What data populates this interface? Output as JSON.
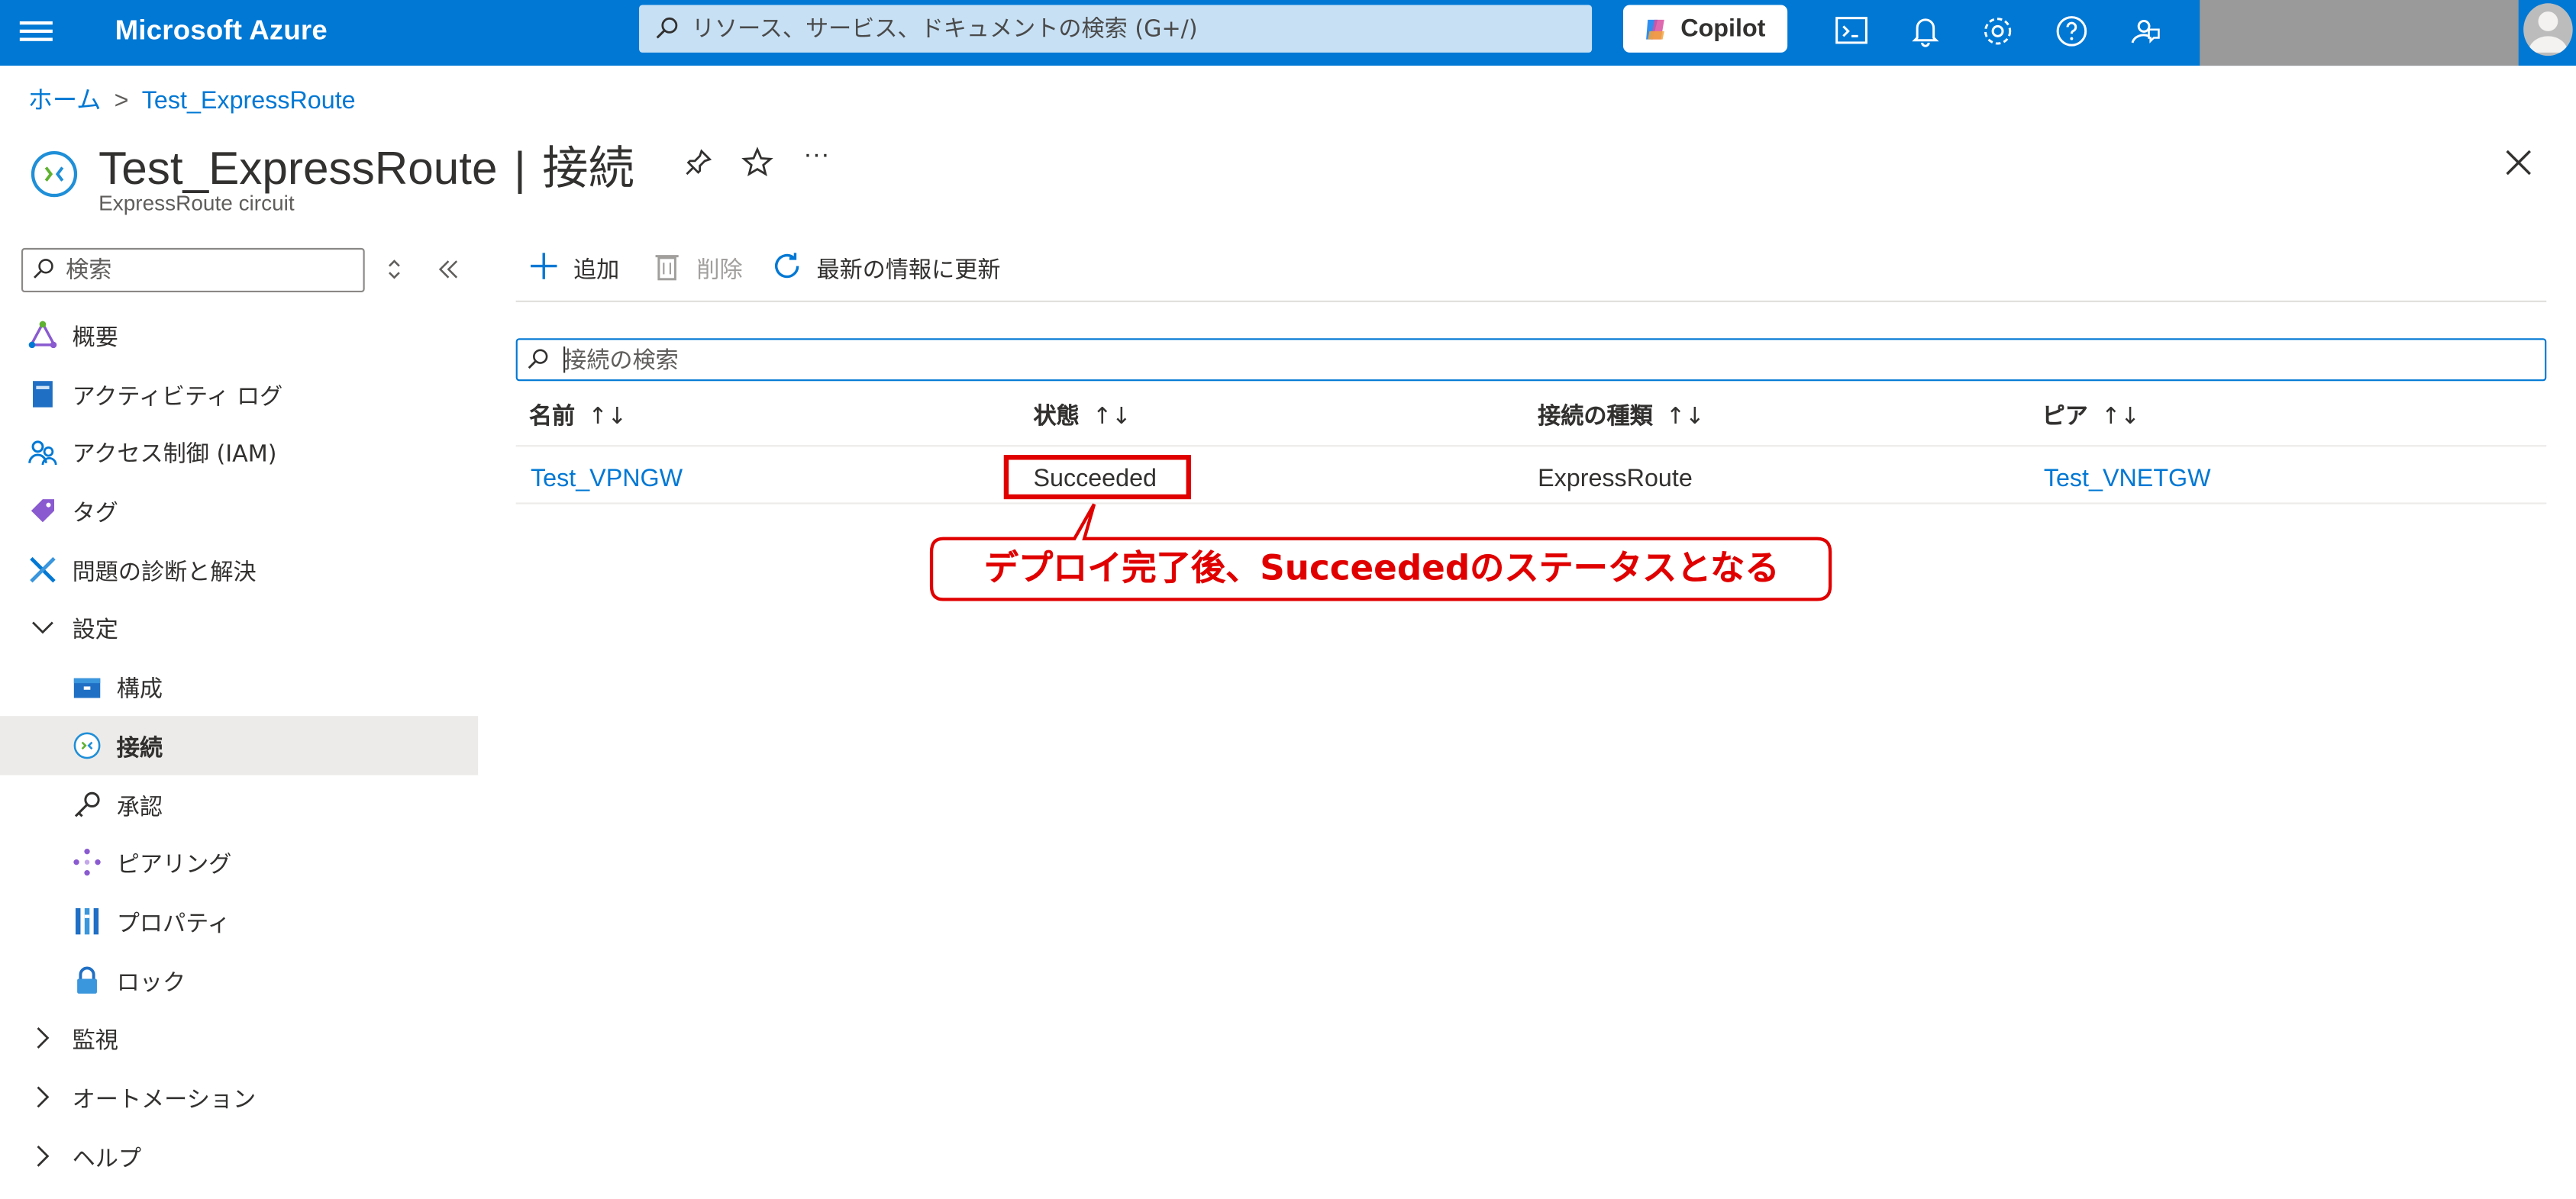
{
  "topbar": {
    "brand": "Microsoft Azure",
    "search_placeholder": "リソース、サービス、ドキュメントの検索 (G+/)",
    "copilot_label": "Copilot",
    "icons": [
      "cloud-shell-icon",
      "notifications-icon",
      "settings-icon",
      "help-icon",
      "feedback-icon"
    ],
    "accent": "#0078d4"
  },
  "breadcrumb": {
    "home": "ホーム",
    "resource": "Test_ExpressRoute"
  },
  "header": {
    "resource_name": "Test_ExpressRoute",
    "separator": "|",
    "page_name": "接続",
    "subtitle": "ExpressRoute circuit",
    "more": "···"
  },
  "nav": {
    "search_placeholder": "検索",
    "items": [
      {
        "label": "概要",
        "icon": "overview-icon"
      },
      {
        "label": "アクティビティ ログ",
        "icon": "activity-log-icon"
      },
      {
        "label": "アクセス制御 (IAM)",
        "icon": "iam-icon"
      },
      {
        "label": "タグ",
        "icon": "tag-icon"
      },
      {
        "label": "問題の診断と解決",
        "icon": "diagnose-icon"
      },
      {
        "label": "設定",
        "icon": "chevron-down-icon"
      },
      {
        "label": "構成",
        "icon": "configuration-icon"
      },
      {
        "label": "接続",
        "icon": "connection-icon",
        "active": true
      },
      {
        "label": "承認",
        "icon": "key-icon"
      },
      {
        "label": "ピアリング",
        "icon": "peering-icon"
      },
      {
        "label": "プロパティ",
        "icon": "properties-icon"
      },
      {
        "label": "ロック",
        "icon": "lock-icon"
      },
      {
        "label": "監視",
        "icon": "chevron-right-icon"
      },
      {
        "label": "オートメーション",
        "icon": "chevron-right-icon"
      },
      {
        "label": "ヘルプ",
        "icon": "chevron-right-icon"
      }
    ]
  },
  "toolbar": {
    "add": "追加",
    "delete": "削除",
    "refresh": "最新の情報に更新"
  },
  "table": {
    "search_placeholder": "接続の検索",
    "sort_glyph": "↑↓",
    "columns": [
      "名前",
      "状態",
      "接続の種類",
      "ピア"
    ],
    "rows": [
      {
        "name": "Test_VPNGW",
        "status": "Succeeded",
        "type": "ExpressRoute",
        "peer": "Test_VNETGW"
      }
    ]
  },
  "annotation": {
    "text": "デプロイ完了後、Succeededのステータスとなる",
    "color": "#e00000"
  }
}
